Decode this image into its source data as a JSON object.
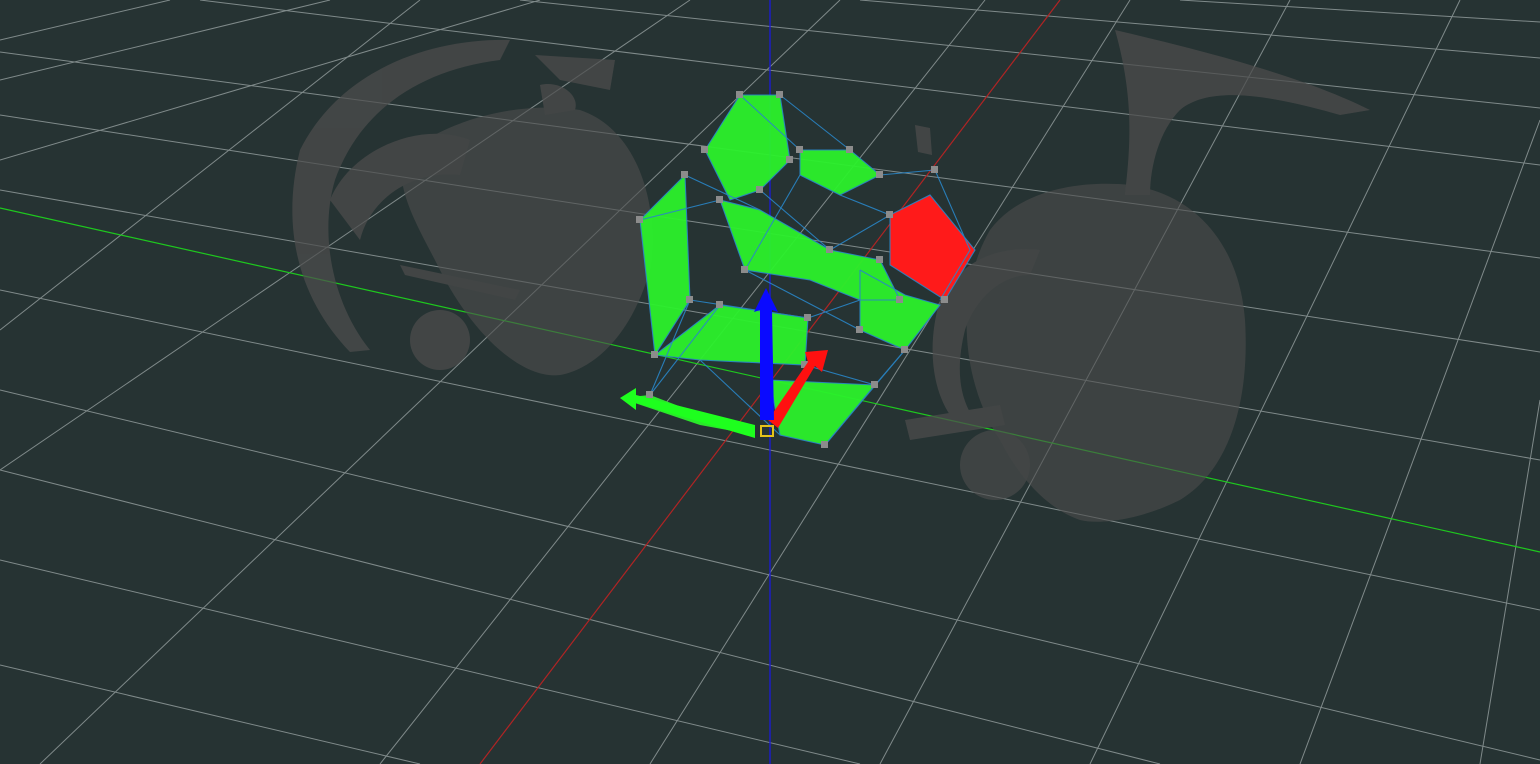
{
  "viewport": {
    "background_color": "#263333",
    "grid_color": "#c9d1d1",
    "axis_colors": {
      "x": "#b02424",
      "y": "#1ec81e",
      "z": "#1c1ccf"
    },
    "selection": {
      "face_color": "#2cf22c",
      "face_color_alt": "#ff1a1a",
      "wire_color": "#2a86c7",
      "vertex_color": "#8c8c8c",
      "pivot_color": "#e6c21a"
    },
    "mesh_color": "#4d4d4d"
  },
  "gizmo": {
    "up_arrow_color": "#0a0aff",
    "side_arrow_color": "#ff1010",
    "front_arrow_color": "#1eff1e"
  },
  "icons": [
    "translate-gizmo-icon",
    "pivot-marker-icon"
  ]
}
